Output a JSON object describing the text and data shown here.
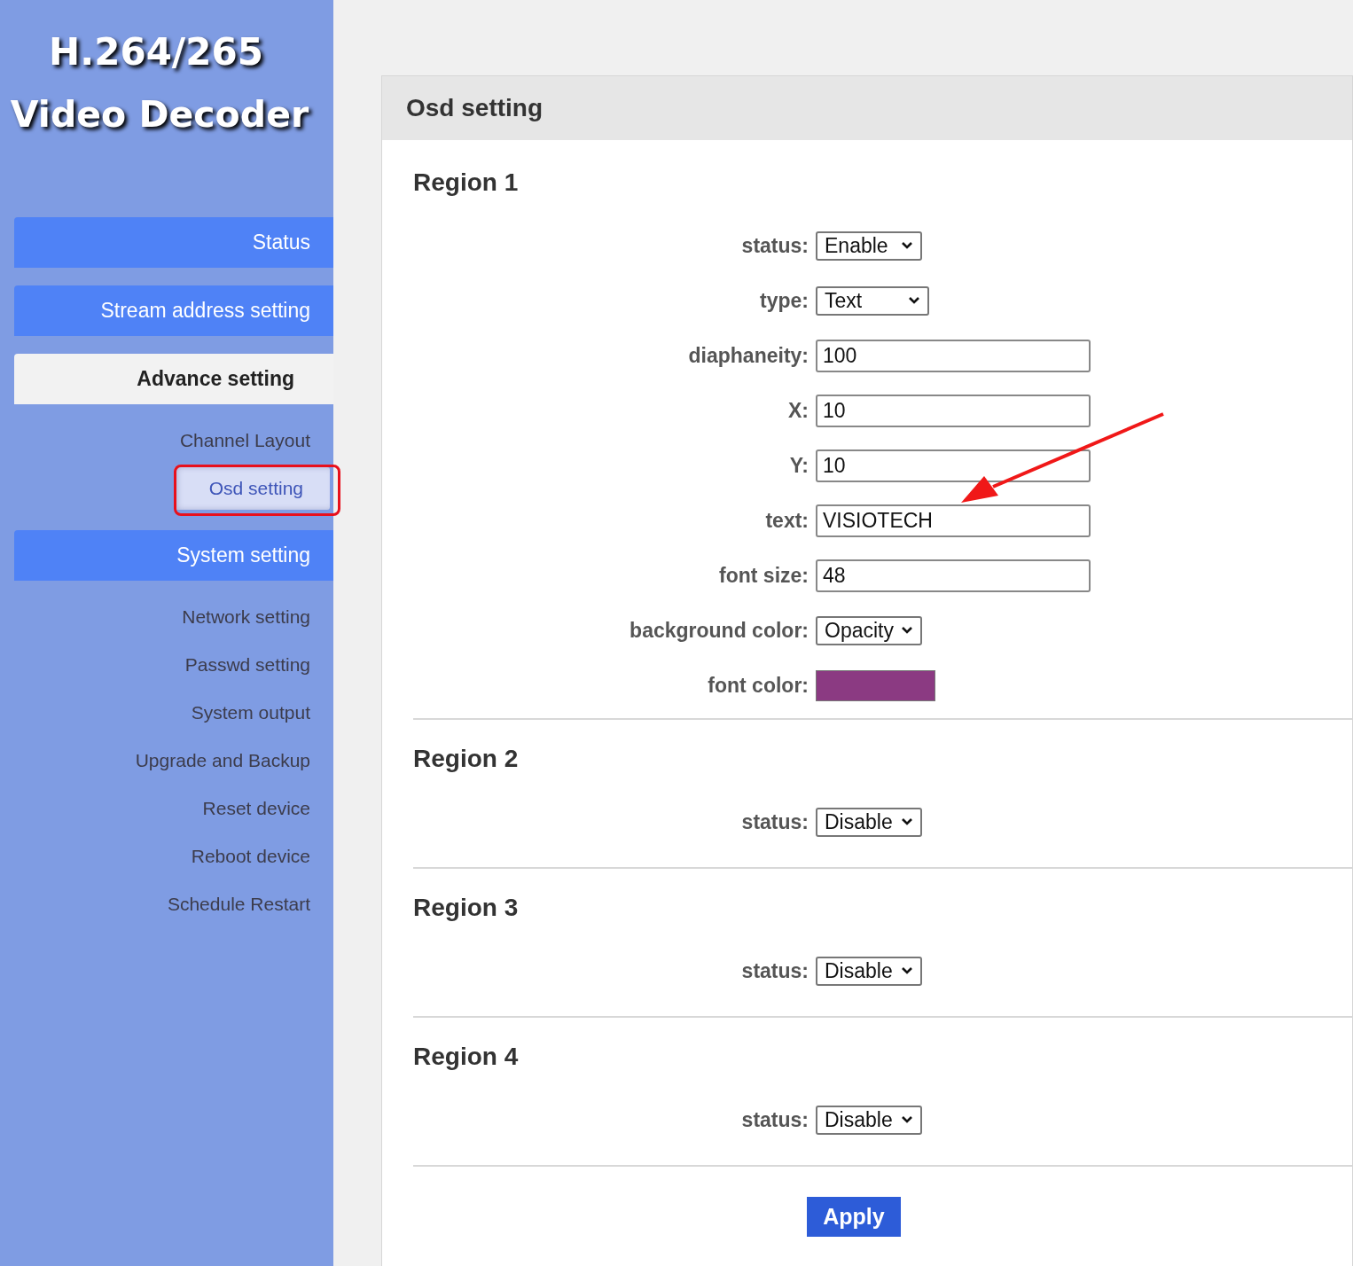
{
  "logo": {
    "line_1": "H.264/265",
    "line_2": "Video Decoder"
  },
  "sidebar": {
    "sections": [
      {
        "label": "Status",
        "selected": false
      },
      {
        "label": "Stream address setting",
        "selected": false
      },
      {
        "label": "Advance setting",
        "selected": true,
        "children": [
          {
            "label": "Channel Layout",
            "selected": false,
            "highlighted": false
          },
          {
            "label": "Osd setting",
            "selected": true,
            "highlighted": true
          }
        ]
      },
      {
        "label": "System setting",
        "selected": false,
        "children": [
          {
            "label": "Network setting",
            "selected": false,
            "highlighted": false
          },
          {
            "label": "Passwd setting",
            "selected": false,
            "highlighted": false
          },
          {
            "label": "System output",
            "selected": false,
            "highlighted": false
          },
          {
            "label": "Upgrade and Backup",
            "selected": false,
            "highlighted": false
          },
          {
            "label": "Reset device",
            "selected": false,
            "highlighted": false
          },
          {
            "label": "Reboot device",
            "selected": false,
            "highlighted": false
          },
          {
            "label": "Schedule Restart",
            "selected": false,
            "highlighted": false
          }
        ]
      }
    ]
  },
  "panel": {
    "title": "Osd setting",
    "regions": [
      {
        "title": "Region 1",
        "fields": [
          {
            "kind": "select",
            "label": "status:",
            "value": "Enable"
          },
          {
            "kind": "select",
            "label": "type:",
            "value": "Text"
          },
          {
            "kind": "input",
            "label": "diaphaneity:",
            "value": "100"
          },
          {
            "kind": "input",
            "label": "X:",
            "value": "10"
          },
          {
            "kind": "input",
            "label": "Y:",
            "value": "10"
          },
          {
            "kind": "input",
            "label": "text:",
            "value": "VISIOTECH"
          },
          {
            "kind": "input",
            "label": "font size:",
            "value": "48"
          },
          {
            "kind": "select",
            "label": "background color:",
            "value": "Opacity"
          },
          {
            "kind": "color",
            "label": "font color:",
            "color": "#8b3a82"
          }
        ]
      },
      {
        "title": "Region 2",
        "fields": [
          {
            "kind": "select",
            "label": "status:",
            "value": "Disable"
          }
        ]
      },
      {
        "title": "Region 3",
        "fields": [
          {
            "kind": "select",
            "label": "status:",
            "value": "Disable"
          }
        ]
      },
      {
        "title": "Region 4",
        "fields": [
          {
            "kind": "select",
            "label": "status:",
            "value": "Disable"
          }
        ]
      }
    ],
    "apply_button": "Apply"
  },
  "annotation_arrow": true
}
